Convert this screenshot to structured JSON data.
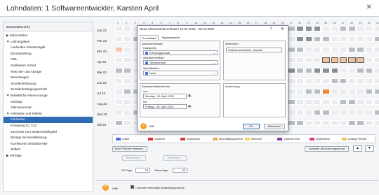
{
  "window": {
    "title": "Lohndaten: 1 Softwareentwickler, Karsten  April"
  },
  "sidebar": {
    "header": "Gesamtübersicht",
    "items": [
      {
        "label": "▶ Stammdaten",
        "group": true
      },
      {
        "label": "▼ Lohnangaben",
        "group": true
      },
      {
        "label": "Laufendes Arbeitsentgelt"
      },
      {
        "label": "Einmalzahlung"
      },
      {
        "label": "VWL"
      },
      {
        "label": "Geldwerter Vorteil"
      },
      {
        "label": "Netto Be- und Abzüge"
      },
      {
        "label": "Dienstwagen"
      },
      {
        "label": "Stundenerfassung"
      },
      {
        "label": "Stundenfestlegungsschaft"
      },
      {
        "label": "▼ betriebliche Altersvorsorge",
        "group": true
      },
      {
        "label": "Verträge"
      },
      {
        "label": "Jahressummen"
      },
      {
        "label": "▼ Fehlzeiten und Teilfeld",
        "group": true
      },
      {
        "label": "Fehlzeiten",
        "selected": true
      },
      {
        "label": "Erstattung U1 / U2"
      },
      {
        "label": "Zuschuss zum Mutterschaftsgeld"
      },
      {
        "label": "Bezüge bei Sozialleistung"
      },
      {
        "label": "Korrekturen Urlaubstrecke"
      },
      {
        "label": "Teilfeld"
      },
      {
        "label": "▶ Verträge",
        "group": true
      }
    ]
  },
  "calendar": {
    "months": [
      "Jan 23",
      "Feb 23",
      "Mrz 23",
      "Apr 23",
      "Mai 23",
      "Jun 23",
      "Jul 23",
      "Aug 23",
      "Sep 23",
      "Okt 23"
    ],
    "days": [
      "1",
      "2",
      "3",
      "4",
      "5",
      "6",
      "7",
      "8",
      "9",
      "10",
      "11",
      "12",
      "13",
      "14",
      "15",
      "16",
      "17",
      "18",
      "19",
      "20",
      "21",
      "22",
      "23",
      "24",
      "25",
      "26",
      "27",
      "28",
      "29",
      "30",
      "31"
    ]
  },
  "legend": [
    {
      "label": "Urlaub",
      "color": "#4a6fd0"
    },
    {
      "label": "Krankheit",
      "color": "#e0322f"
    },
    {
      "label": "Krankurlaub",
      "color": "#d43c3c"
    },
    {
      "label": "Beschäftigungsverbot",
      "color": "#e8a85a"
    },
    {
      "label": "Elternzeit",
      "color": "#f3d35b"
    },
    {
      "label": "Krankheit Kind",
      "color": "#7b3fa0"
    },
    {
      "label": "Mutterschutz",
      "color": "#d83a8a"
    },
    {
      "label": "sonstige Fehlzeit",
      "color": "#f6c25a"
    }
  ],
  "actions": {
    "new": "Neue Fehlzeit erfassen...",
    "edit": "Bearbeiten...",
    "remove": "Entfernen...",
    "current": "Aktueller Abrechnungsmonat",
    "up": "▲",
    "down": "▼"
  },
  "counters": {
    "sv_label": "SV-Tage:",
    "sv_value": "30",
    "st_label": "Steuertage:",
    "st_value": "30"
  },
  "footer": {
    "help": "Hilfe",
    "checkbox": "Lesende ehemalige Anstellungsperiode"
  },
  "dialog": {
    "title": "Neue Abwesenheit erfassen 24.04.2024 - 28.04.2024",
    "help_glyph": "?",
    "close_glyph": "✕",
    "tabs": [
      "Grunddaten",
      "Tagesangaben"
    ],
    "abw_header": "Abwesenheitsart",
    "kategorie_label": "Kategorien",
    "kategorie_value": "Erholungsurlaub",
    "abw_label": "Abwesenheitsart",
    "abw_value": "Jahresurlaub",
    "spez_label": "Spezifikation",
    "spez_value": "keine",
    "zeitraum_header": "Abwesenheitszeitraum",
    "von_label": "von",
    "von_value": "Montag , 24.   April    2024",
    "bis_label": "bis",
    "bis_value": "Freitag , 28.   April    2024",
    "mitarbeiter_header": "Mitarbeiter",
    "mitarbeiter_value": "Softwareentwickler, Karsten",
    "anmerkung_header": "Anmerkung",
    "ok": "OK",
    "cancel": "Abbrechen",
    "help": "Hilfe"
  }
}
